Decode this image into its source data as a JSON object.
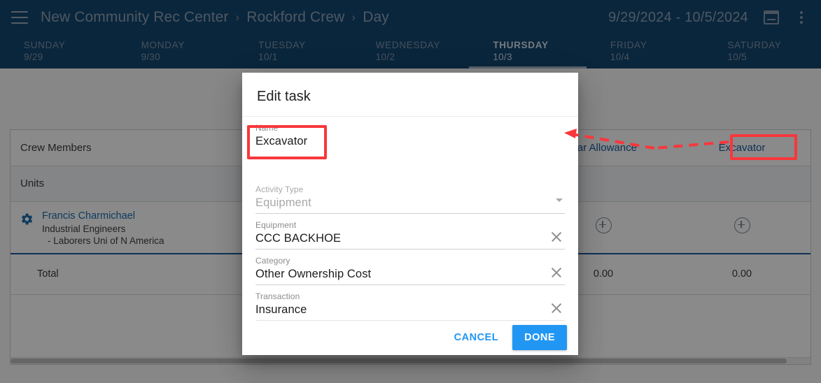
{
  "appbar": {
    "menu_icon": "hamburger-menu-icon",
    "breadcrumb": [
      {
        "label": "New Community Rec Center"
      },
      {
        "label": "Rockford Crew"
      },
      {
        "label": "Day"
      }
    ],
    "breadcrumb_separator": "›",
    "date_range": "9/29/2024 - 10/5/2024",
    "calendar_icon": "calendar-icon",
    "overflow_icon": "kebab-menu-icon",
    "bg_color": "#14466f",
    "text_color": "#8fa3b6"
  },
  "day_tabs": [
    {
      "name": "SUNDAY",
      "date": "9/29",
      "active": false
    },
    {
      "name": "MONDAY",
      "date": "9/30",
      "active": false
    },
    {
      "name": "TUESDAY",
      "date": "10/1",
      "active": false
    },
    {
      "name": "WEDNESDAY",
      "date": "10/2",
      "active": false
    },
    {
      "name": "THURSDAY",
      "date": "10/3",
      "active": true
    },
    {
      "name": "FRIDAY",
      "date": "10/4",
      "active": false
    },
    {
      "name": "SATURDAY",
      "date": "10/5",
      "active": false
    }
  ],
  "grid": {
    "header_row": {
      "label": "Crew Members",
      "columns": [
        "",
        "",
        "Car Allowance",
        "Excavator"
      ]
    },
    "units_row": {
      "label": "Units"
    },
    "crew_row": {
      "gear_icon": "settings-gear-icon",
      "name": "Francis Charmichael",
      "trade": "Industrial Engineers",
      "union": "- Laborers Uni of N America",
      "add_icon": "plus-circle-icon"
    },
    "total_row": {
      "label": "Total",
      "car_allowance": "0.00",
      "excavator": "0.00"
    }
  },
  "dialog": {
    "title": "Edit task",
    "fields": [
      {
        "label": "Name",
        "value": "Excavator",
        "control": "text",
        "disabled": false,
        "clearable": false
      },
      {
        "label": "Activity Type",
        "value": "Equipment",
        "control": "select",
        "disabled": true,
        "clearable": false
      },
      {
        "label": "Equipment",
        "value": "CCC BACKHOE",
        "control": "text",
        "disabled": false,
        "clearable": true
      },
      {
        "label": "Category",
        "value": "Other Ownership Cost",
        "control": "text",
        "disabled": false,
        "clearable": true
      },
      {
        "label": "Transaction",
        "value": "Insurance",
        "control": "text",
        "disabled": false,
        "clearable": true
      }
    ],
    "cancel_label": "CANCEL",
    "done_label": "DONE",
    "accent_color": "#2196f3"
  },
  "annotations": {
    "highlight_color": "#f8373c",
    "boxes": [
      "name-field",
      "excavator-column-header"
    ],
    "arrow": "dashed-arrow-from-excavator-header-to-name-field"
  }
}
